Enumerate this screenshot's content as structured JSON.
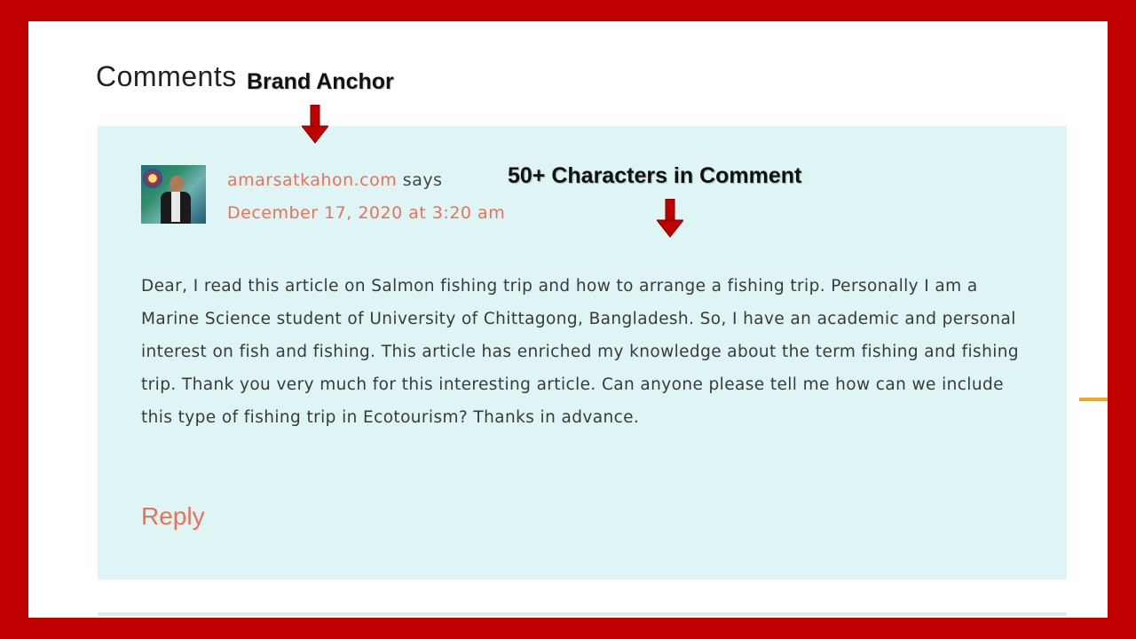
{
  "section": {
    "heading": "Comments"
  },
  "comment": {
    "author": "amarsatkahon.com",
    "says": "says",
    "date": "December 17, 2020 at 3:20 am",
    "text": "Dear, I read this article on Salmon fishing trip and how to arrange a fishing trip. Personally I am a Marine Science student of University of Chittagong, Bangladesh. So, I have an academic and personal interest on fish and fishing. This article has enriched my knowledge about the term fishing and fishing trip. Thank you very much for this interesting article. Can anyone please tell me how can we include this type of fishing trip in Ecotourism? Thanks in advance.",
    "reply_label": "Reply",
    "avatar_icon": "user-avatar-photo"
  },
  "annotations": {
    "brand_anchor": "Brand Anchor",
    "characters": "50+ Characters in Comment",
    "arrow_icon": "arrow-down-icon"
  },
  "colors": {
    "frame": "#c00000",
    "comment_bg": "#dff4f4",
    "link": "#e8725a",
    "accent": "#f4a623"
  }
}
